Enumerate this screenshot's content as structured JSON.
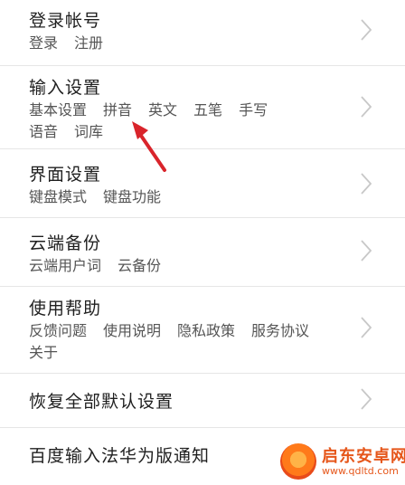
{
  "rows": [
    {
      "title": "登录帐号",
      "subs": [
        "登录",
        "注册"
      ]
    },
    {
      "title": "输入设置",
      "subs": [
        "基本设置",
        "拼音",
        "英文",
        "五笔",
        "手写",
        "语音",
        "词库"
      ]
    },
    {
      "title": "界面设置",
      "subs": [
        "键盘模式",
        "键盘功能"
      ]
    },
    {
      "title": "云端备份",
      "subs": [
        "云端用户词",
        "云备份"
      ]
    },
    {
      "title": "使用帮助",
      "subs": [
        "反馈问题",
        "使用说明",
        "隐私政策",
        "服务协议",
        "关于"
      ]
    },
    {
      "title": "恢复全部默认设置"
    },
    {
      "title": "百度输入法华为版通知"
    }
  ],
  "annotation": {
    "color": "#d9242b"
  },
  "watermark": {
    "name": "启东安卓网",
    "url": "www.qdltd.com"
  }
}
